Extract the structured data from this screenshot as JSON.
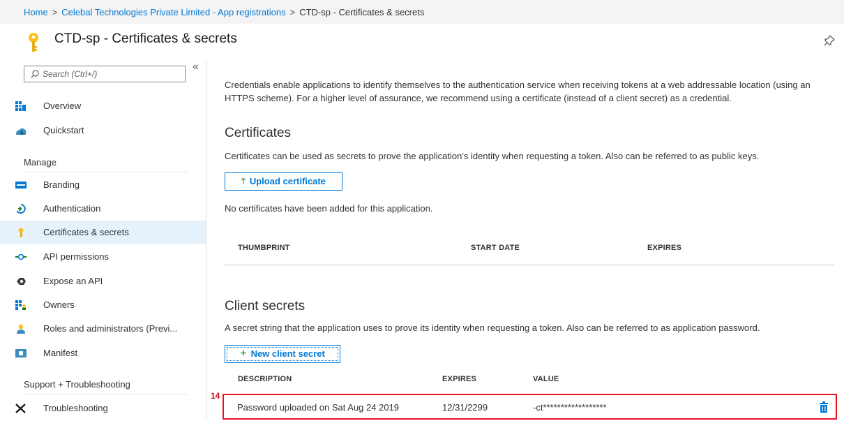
{
  "breadcrumb": {
    "items": [
      "Home",
      "Celebal Technologies Private Limited - App registrations",
      "CTD-sp - Certificates & secrets"
    ],
    "separator": ">"
  },
  "header": {
    "title": "CTD-sp - Certificates & secrets",
    "title_icon": "key-icon",
    "pin_icon": "pin-icon"
  },
  "sidebar": {
    "search_placeholder": "Search (Ctrl+/)",
    "collapse_glyph": "«",
    "items": [
      {
        "label": "Overview",
        "icon": "overview-icon"
      },
      {
        "label": "Quickstart",
        "icon": "quickstart-icon"
      }
    ],
    "manage_header": "Manage",
    "manage_items": [
      {
        "label": "Branding",
        "icon": "branding-icon"
      },
      {
        "label": "Authentication",
        "icon": "authentication-icon"
      },
      {
        "label": "Certificates & secrets",
        "icon": "key-icon",
        "active": true
      },
      {
        "label": "API permissions",
        "icon": "api-permissions-icon"
      },
      {
        "label": "Expose an API",
        "icon": "expose-api-icon"
      },
      {
        "label": "Owners",
        "icon": "owners-icon"
      },
      {
        "label": "Roles and administrators (Previ...",
        "icon": "roles-icon"
      },
      {
        "label": "Manifest",
        "icon": "manifest-icon"
      }
    ],
    "support_header": "Support + Troubleshooting",
    "support_items": [
      {
        "label": "Troubleshooting",
        "icon": "troubleshooting-icon"
      }
    ]
  },
  "main": {
    "intro": "Credentials enable applications to identify themselves to the authentication service when receiving tokens at a web addressable location (using an HTTPS scheme). For a higher level of assurance, we recommend using a certificate (instead of a client secret) as a credential.",
    "certificates": {
      "heading": "Certificates",
      "description": "Certificates can be used as secrets to prove the application's identity when requesting a token. Also can be referred to as public keys.",
      "upload_button": "Upload certificate",
      "empty_text": "No certificates have been added for this application.",
      "columns": [
        "THUMBPRINT",
        "START DATE",
        "EXPIRES"
      ]
    },
    "client_secrets": {
      "heading": "Client secrets",
      "description": "A secret string that the application uses to prove its identity when requesting a token. Also can be referred to as application password.",
      "new_button": "New client secret",
      "columns": [
        "DESCRIPTION",
        "EXPIRES",
        "VALUE"
      ],
      "rows": [
        {
          "description": "Password uploaded on Sat Aug 24 2019",
          "expires": "12/31/2299",
          "value": "-ct******************"
        }
      ]
    }
  },
  "annotation_number": "14",
  "colors": {
    "accent": "#0078d4",
    "highlight_border": "#e81123",
    "active_nav": "#e5f1fb"
  }
}
